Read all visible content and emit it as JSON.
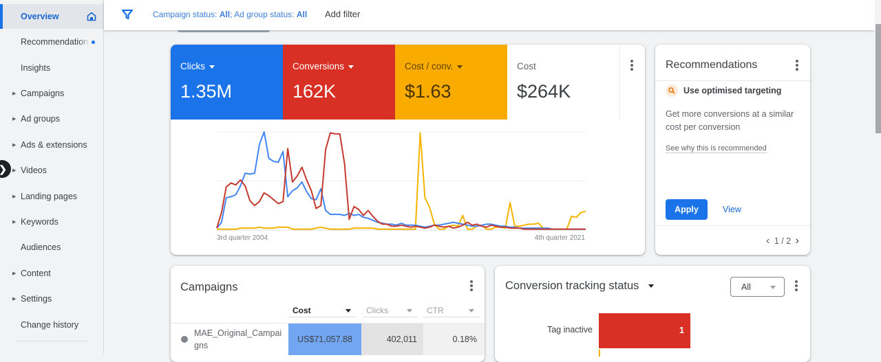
{
  "sidebar": {
    "items": [
      {
        "label": "Overview",
        "expandable": false,
        "active": true
      },
      {
        "label": "Recommendations",
        "expandable": false,
        "active": false
      },
      {
        "label": "Insights",
        "expandable": false,
        "active": false
      },
      {
        "label": "Campaigns",
        "expandable": true,
        "active": false
      },
      {
        "label": "Ad groups",
        "expandable": true,
        "active": false
      },
      {
        "label": "Ads & extensions",
        "expandable": true,
        "active": false
      },
      {
        "label": "Videos",
        "expandable": true,
        "active": false
      },
      {
        "label": "Landing pages",
        "expandable": true,
        "active": false
      },
      {
        "label": "Keywords",
        "expandable": true,
        "active": false
      },
      {
        "label": "Audiences",
        "expandable": false,
        "active": false
      },
      {
        "label": "Content",
        "expandable": true,
        "active": false
      },
      {
        "label": "Settings",
        "expandable": true,
        "active": false
      },
      {
        "label": "Change history",
        "expandable": false,
        "active": false
      }
    ],
    "arrow_glyph": "▶",
    "expand_glyph": "❯"
  },
  "filterbar": {
    "campaign_status_label": "Campaign status: ",
    "campaign_status_value": "All",
    "separator": "; ",
    "adgroup_status_label": "Ad group status: ",
    "adgroup_status_value": "All",
    "add_filter": "Add filter"
  },
  "overview_card": {
    "metrics": [
      {
        "label": "Clicks",
        "value": "1.35M",
        "color": "#1a73e8",
        "dropdown": true
      },
      {
        "label": "Conversions",
        "value": "162K",
        "color": "#d93025",
        "dropdown": true
      },
      {
        "label": "Cost / conv.",
        "value": "$1.63",
        "color": "#f9ab00",
        "dropdown": true
      },
      {
        "label": "Cost",
        "value": "$264K",
        "color": "#ffffff",
        "dropdown": false
      }
    ],
    "x_start_label": "3rd quarter 2004",
    "x_end_label": "4th quarter 2021"
  },
  "chart_data": {
    "type": "line",
    "title": "",
    "xlabel": "",
    "ylabel": "",
    "x_range": [
      "3rd quarter 2004",
      "4th quarter 2021"
    ],
    "ylim": [
      0,
      100
    ],
    "grid": true,
    "legend": "none",
    "series": [
      {
        "name": "Clicks",
        "color": "#4285f4",
        "values": [
          2,
          8,
          33,
          34,
          36,
          45,
          58,
          57,
          58,
          87,
          100,
          73,
          70,
          69,
          80,
          34,
          40,
          43,
          49,
          39,
          32,
          31,
          42,
          20,
          16,
          16,
          16,
          15,
          17,
          15,
          16,
          13,
          12,
          10,
          8,
          7,
          6,
          6,
          5,
          7,
          5,
          5,
          5,
          4,
          3,
          4,
          5,
          5,
          6,
          7,
          8,
          7,
          6,
          5,
          4,
          4,
          5,
          6,
          6,
          5,
          4,
          4,
          3,
          3,
          2,
          2,
          2,
          2,
          2,
          2,
          2,
          1,
          1,
          1,
          1,
          1,
          1,
          1,
          1
        ]
      },
      {
        "name": "Conversions",
        "color": "#c5392e",
        "values": [
          2,
          18,
          44,
          48,
          46,
          51,
          45,
          30,
          25,
          29,
          38,
          35,
          31,
          27,
          29,
          83,
          49,
          55,
          64,
          51,
          40,
          22,
          25,
          82,
          99,
          98,
          98,
          68,
          11,
          24,
          21,
          15,
          20,
          14,
          9,
          6,
          6,
          4,
          4,
          5,
          4,
          3,
          4,
          3,
          2,
          3,
          5,
          4,
          3,
          4,
          2,
          3,
          5,
          8,
          5,
          6,
          4,
          3,
          5,
          4,
          3,
          3,
          2,
          2,
          2,
          1,
          1,
          1,
          1,
          1,
          1,
          1,
          1,
          1,
          1,
          1,
          1,
          1,
          1
        ]
      },
      {
        "name": "Cost / conv.",
        "color": "#f4b400",
        "values": [
          1,
          1,
          1,
          1,
          1,
          2,
          2,
          2,
          2,
          3,
          2,
          2,
          2,
          3,
          3,
          3,
          1,
          1,
          1,
          1,
          1,
          2,
          3,
          2,
          1,
          1,
          1,
          1,
          1,
          2,
          2,
          2,
          2,
          2,
          1,
          1,
          1,
          1,
          1,
          1,
          1,
          1,
          1,
          99,
          33,
          23,
          6,
          1,
          1,
          4,
          5,
          4,
          15,
          1,
          1,
          4,
          5,
          1,
          1,
          3,
          3,
          2,
          28,
          4,
          4,
          5,
          6,
          6,
          7,
          2,
          1,
          1,
          1,
          1,
          1,
          14,
          13,
          18,
          19
        ]
      }
    ]
  },
  "recommendations": {
    "title": "Recommendations",
    "item_title": "Use optimised targeting",
    "item_description": "Get more conversions at a similar cost per conversion",
    "why_link": "See why this is recommended",
    "apply_label": "Apply",
    "view_label": "View",
    "pager_prev": "‹",
    "pager_text": "1 / 2",
    "pager_next": "›"
  },
  "campaigns": {
    "title": "Campaigns",
    "columns": [
      {
        "label": "Cost",
        "active": true
      },
      {
        "label": "Clicks",
        "active": false
      },
      {
        "label": "CTR",
        "active": false
      }
    ],
    "rows": [
      {
        "name": "MAE_Original_Campaigns",
        "name_line1": "MAE_Original_Campai",
        "name_line2": "gns",
        "cost": "US$71,057.88",
        "clicks": "402,011",
        "ctr": "0.18%"
      }
    ]
  },
  "conversion_tracking": {
    "title": "Conversion tracking status",
    "filter_value": "All",
    "bars": [
      {
        "label": "Tag inactive",
        "value": 1,
        "color": "#d93025"
      }
    ]
  }
}
